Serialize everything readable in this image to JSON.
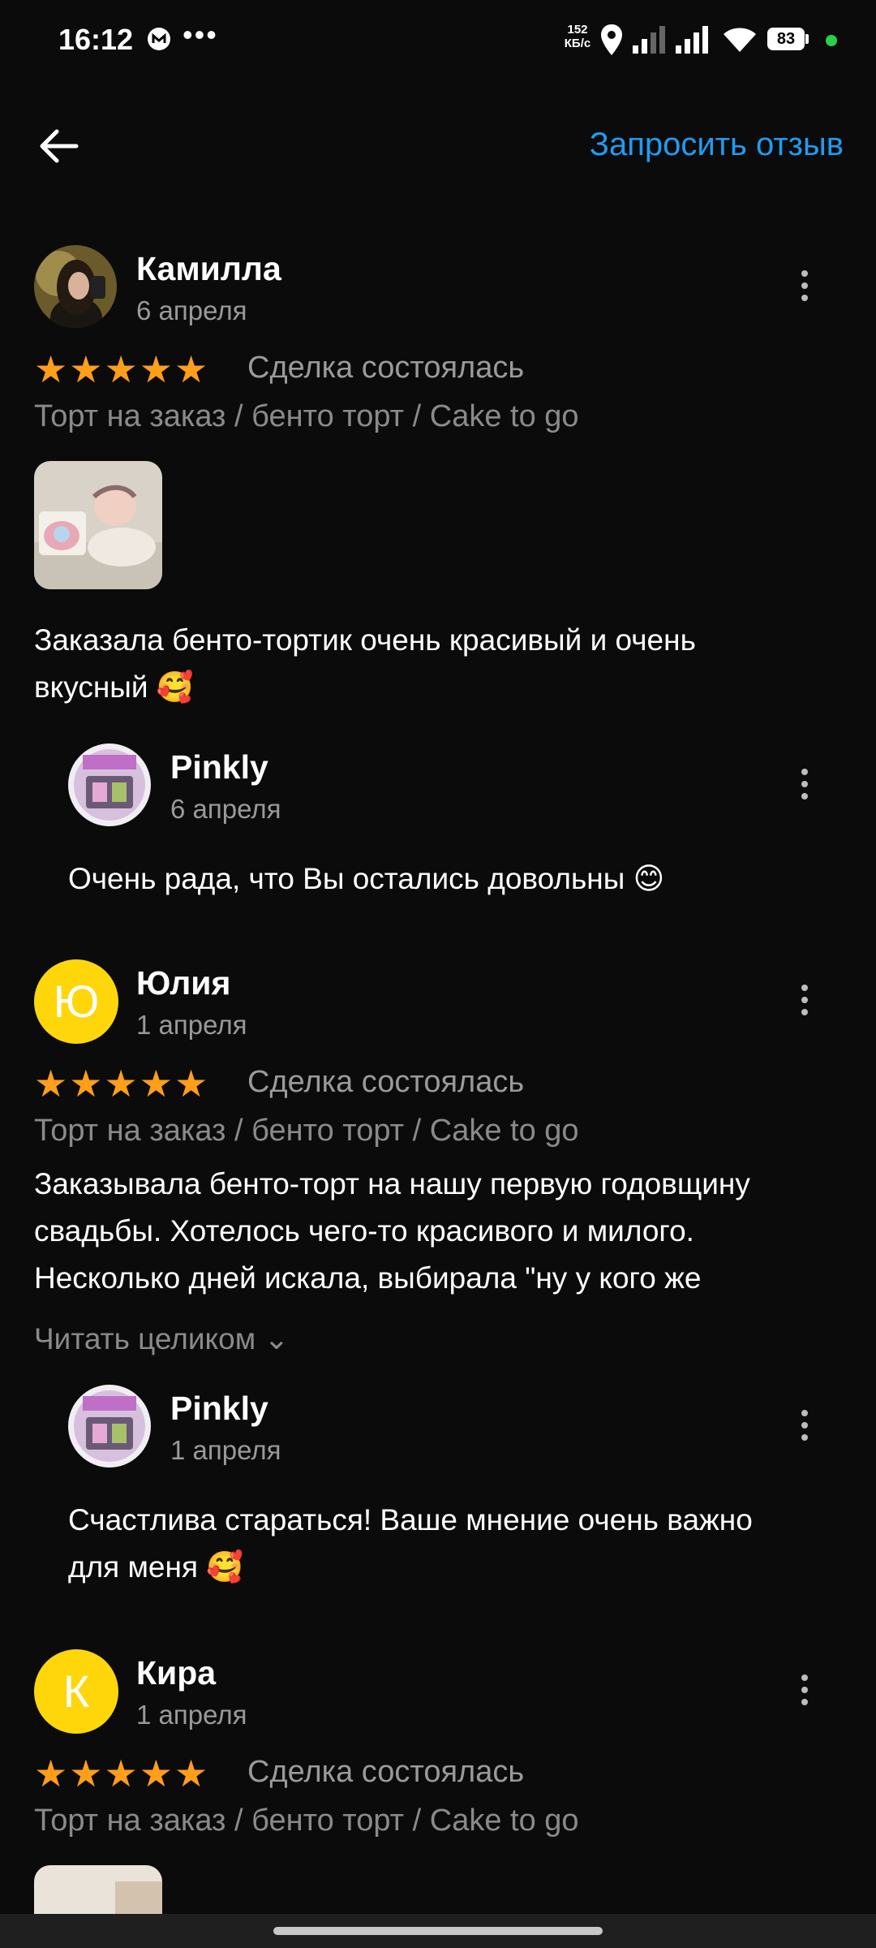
{
  "status_bar": {
    "time": "16:12",
    "more": "•••",
    "netspeed_value": "152",
    "netspeed_unit": "КБ/с",
    "battery": "83"
  },
  "header": {
    "back_icon": "arrow-left-icon",
    "request_review": "Запросить отзыв"
  },
  "reviews": [
    {
      "author": "Камилла",
      "date": "6 апреля",
      "stars": "★★★★★",
      "deal": "Сделка состоялась",
      "category": "Торт на заказ / бенто торт / Cake to go",
      "text_line1": "Заказала бенто-тортик очень красивый и очень",
      "text_line2": "вкусный 🥰",
      "reply": {
        "author": "Pinkly",
        "date": "6 апреля",
        "text": "Очень рада, что Вы остались довольны 😊"
      }
    },
    {
      "author": "Юлия",
      "initial": "Ю",
      "date": "1 апреля",
      "stars": "★★★★★",
      "deal": "Сделка состоялась",
      "category": "Торт на заказ / бенто торт / Cake to go",
      "text_line1": "Заказывала бенто-торт на нашу первую годовщину",
      "text_line2": "свадьбы. Хотелось чего-то красивого и милого.",
      "text_line3": "Несколько дней искала, выбирала \"ну у кого же",
      "read_more": "Читать целиком ⌄",
      "reply": {
        "author": "Pinkly",
        "date": "1 апреля",
        "text_line1": "Счастлива стараться! Ваше мнение очень важно",
        "text_line2": "для меня 🥰"
      }
    },
    {
      "author": "Кира",
      "initial": "К",
      "date": "1 апреля",
      "stars": "★★★★★",
      "deal": "Сделка состоялась",
      "category": "Торт на заказ / бенто торт / Cake to go"
    }
  ],
  "colors": {
    "background": "#0b0b0b",
    "accent": "#1e9df2",
    "stars": "#ff9e1b",
    "avatar_yellow": "#ffd60a"
  }
}
